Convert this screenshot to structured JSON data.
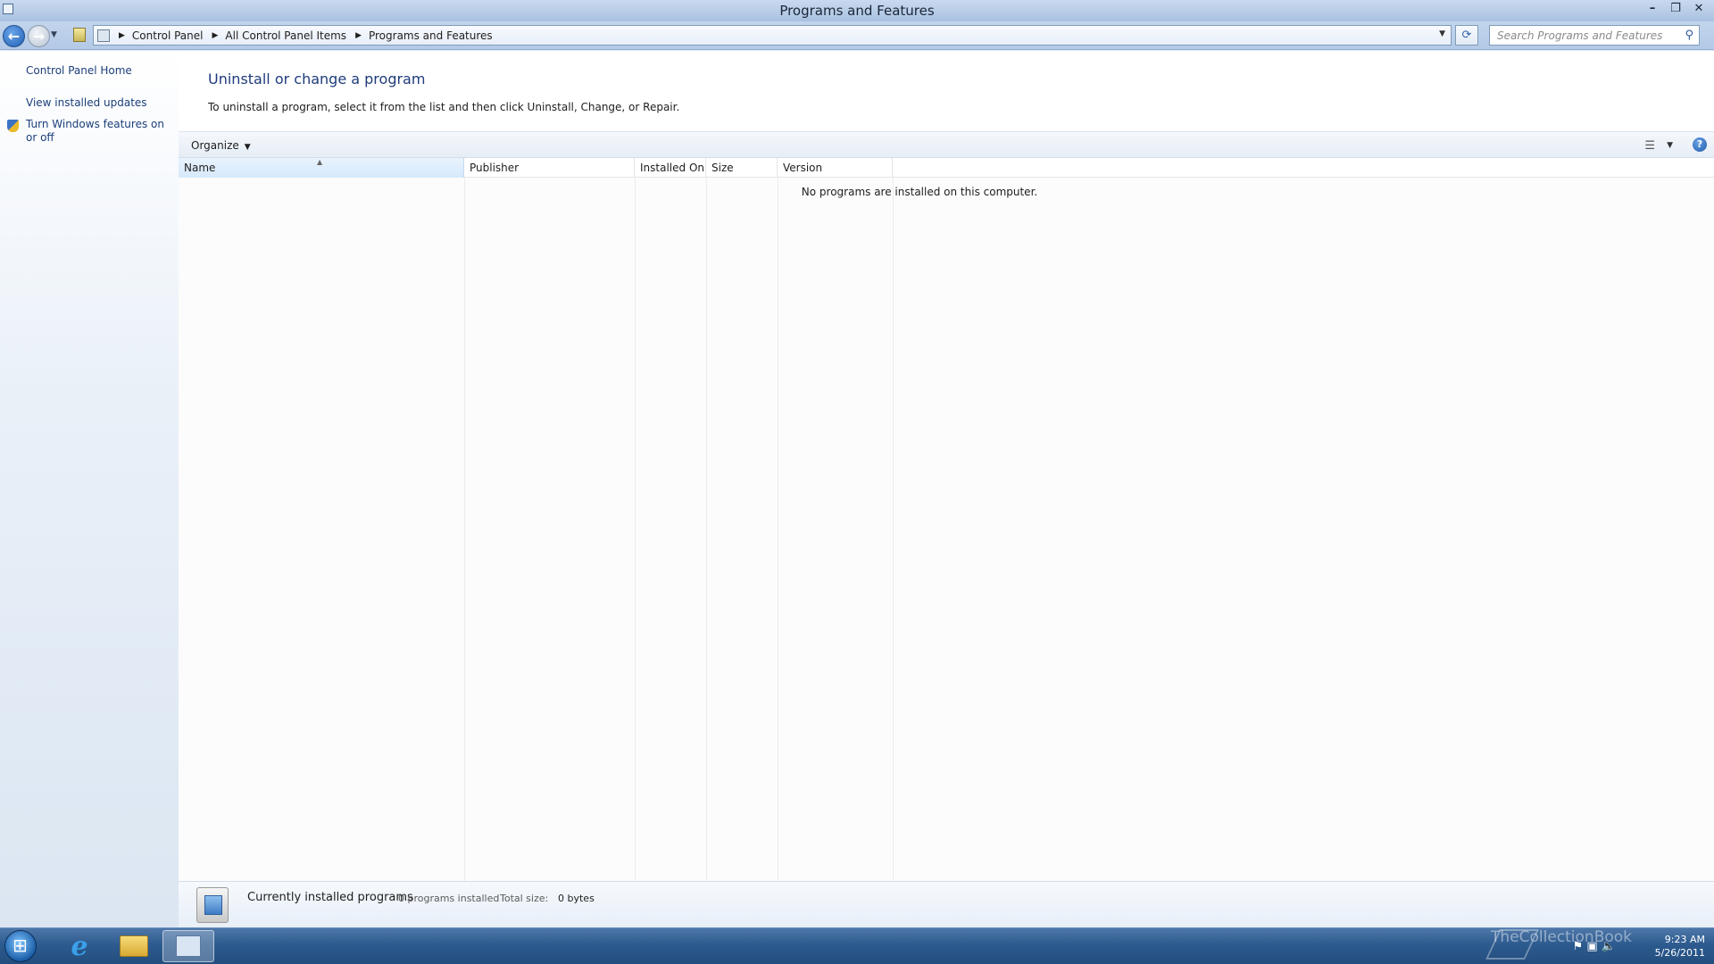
{
  "window": {
    "title": "Programs and Features"
  },
  "address_bar": {
    "breadcrumbs": [
      "Control Panel",
      "All Control Panel Items",
      "Programs and Features"
    ]
  },
  "search": {
    "placeholder": "Search Programs and Features"
  },
  "left_pane": {
    "home": "Control Panel Home",
    "updates": "View installed updates",
    "features": "Turn Windows features on or off"
  },
  "main": {
    "title": "Uninstall or change a program",
    "description": "To uninstall a program, select it from the list and then click Uninstall, Change, or Repair.",
    "toolbar": {
      "organize": "Organize"
    },
    "columns": [
      "Name",
      "Publisher",
      "Installed On",
      "Size",
      "Version"
    ],
    "empty_message": "No programs are installed on this computer."
  },
  "details_pane": {
    "label": "Currently installed programs",
    "count": "0 programs installed",
    "total_size_label": "Total size:",
    "total_size_value": "0 bytes"
  },
  "taskbar": {
    "time": "9:23 AM",
    "date": "5/26/2011",
    "watermark": "TheCollectionBook"
  }
}
